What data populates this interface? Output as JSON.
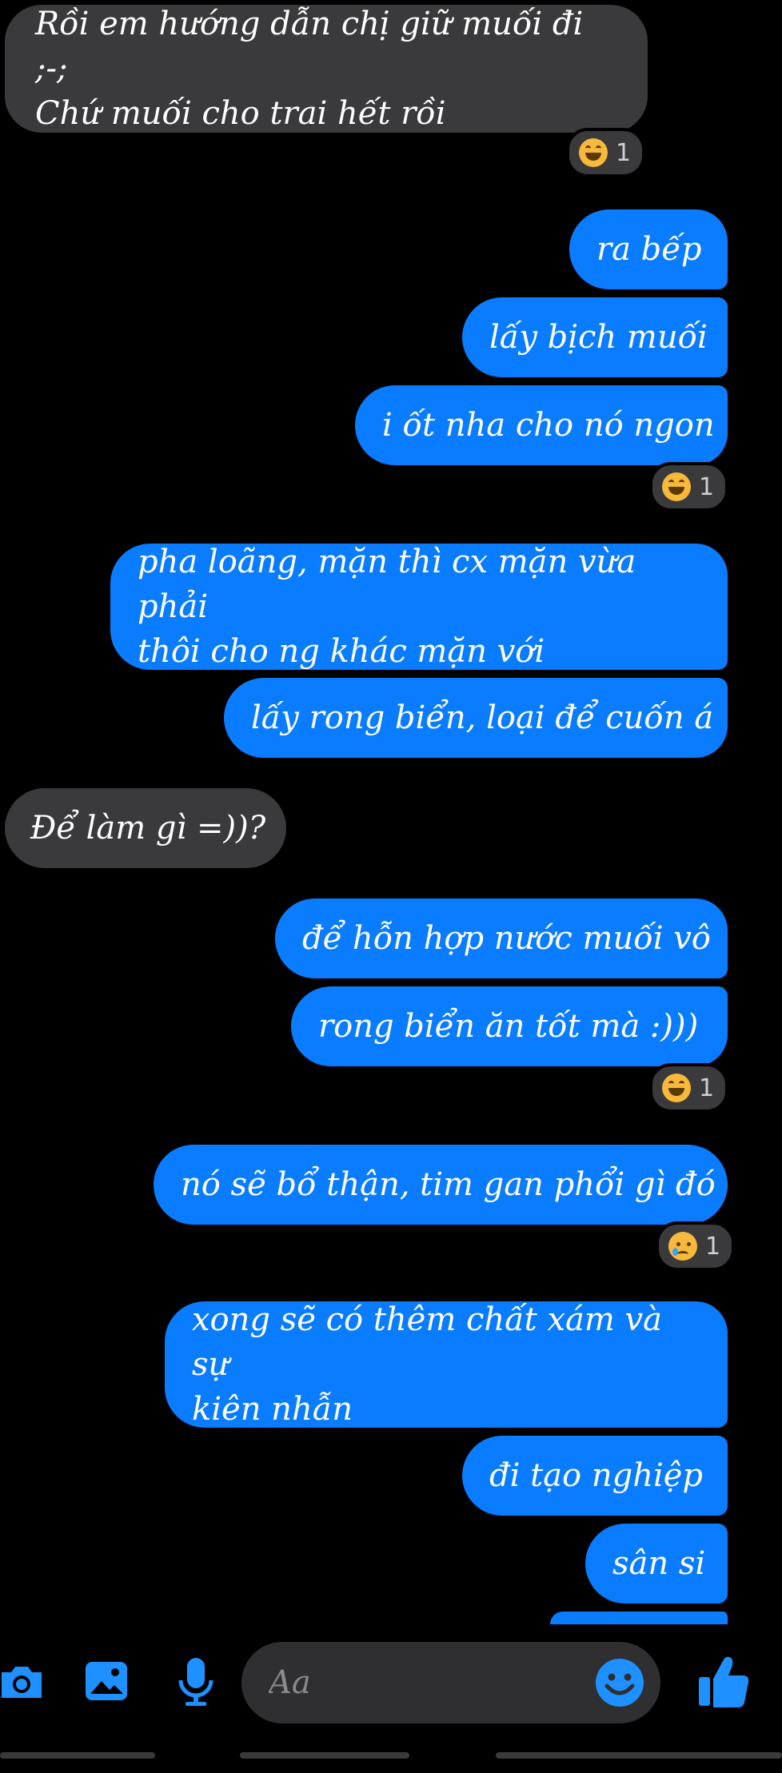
{
  "conversation": {
    "messages": [
      {
        "sender": "other",
        "lines": [
          "Rồi em hướng dẫn chị giữ muối đi ;-;",
          "Chứ muối cho trai hết rồi"
        ]
      },
      {
        "sender": "me",
        "text": "ra bếp"
      },
      {
        "sender": "me",
        "text": "lấy bịch muối"
      },
      {
        "sender": "me",
        "text": "i ốt nha cho nó ngon"
      },
      {
        "sender": "me",
        "lines": [
          "pha loãng, mặn thì cx mặn vừa phải",
          "thôi cho ng khác mặn với"
        ]
      },
      {
        "sender": "me",
        "text": "lấy rong biển, loại để cuốn á"
      },
      {
        "sender": "other",
        "text": "Để làm gì =))?"
      },
      {
        "sender": "me",
        "text": "để hỗn hợp nước muối vô"
      },
      {
        "sender": "me",
        "text": "rong biển ăn tốt mà :)))"
      },
      {
        "sender": "me",
        "text": "nó sẽ bổ thận, tim gan phổi gì đó"
      },
      {
        "sender": "me",
        "lines": [
          "xong sẽ có thêm chất xám và sự",
          "kiên nhẫn"
        ]
      },
      {
        "sender": "me",
        "text": "đi tạo nghiệp"
      },
      {
        "sender": "me",
        "text": "sân si"
      }
    ],
    "reactions": [
      {
        "emoji": "laughing-face",
        "count": "1"
      },
      {
        "emoji": "laughing-face",
        "count": "1"
      },
      {
        "emoji": "laughing-face",
        "count": "1"
      },
      {
        "emoji": "crying-face",
        "count": "1"
      }
    ]
  },
  "composer": {
    "placeholder": "Aa",
    "icons": [
      "camera-icon",
      "image-icon",
      "microphone-icon",
      "emoji-icon",
      "thumbs-up-icon"
    ]
  },
  "colors": {
    "background": "#000000",
    "received_bubble": "#3a3a3c",
    "sent_bubble": "#0a7cff",
    "accent": "#1e90ff"
  }
}
